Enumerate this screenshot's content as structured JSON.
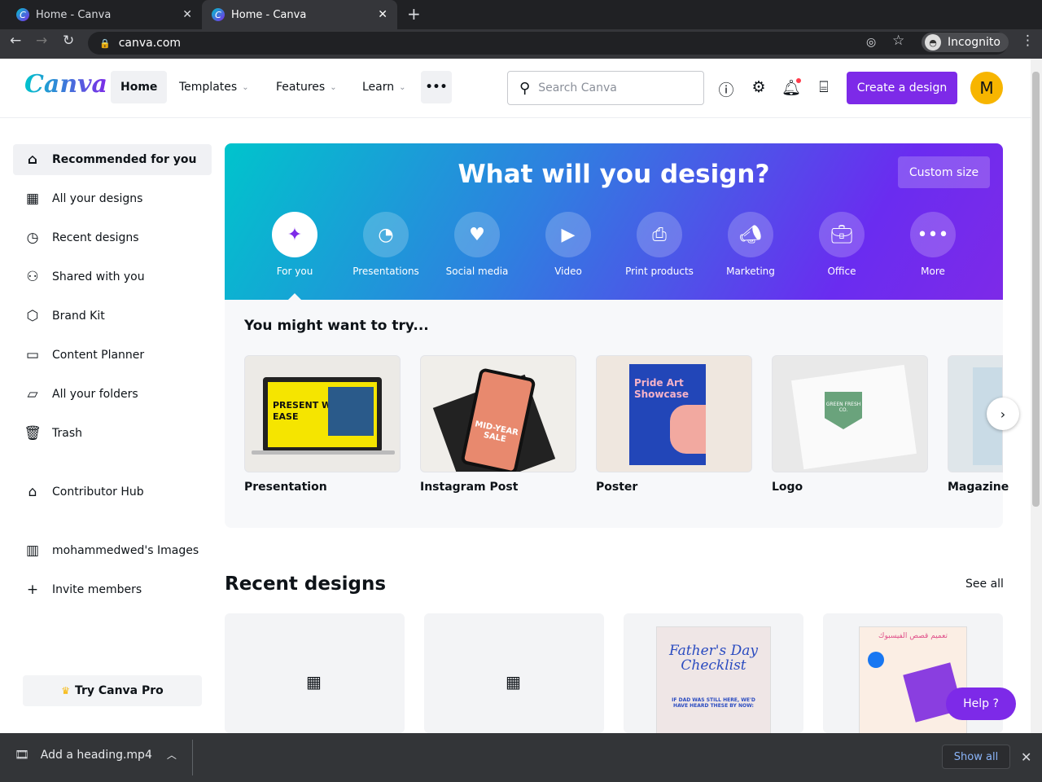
{
  "browser": {
    "tabs": [
      {
        "title": "Home - Canva"
      },
      {
        "title": "Home - Canva"
      }
    ],
    "url": "canva.com",
    "profile": "Incognito"
  },
  "header": {
    "logo": "Canva",
    "nav": [
      {
        "label": "Home"
      },
      {
        "label": "Templates"
      },
      {
        "label": "Features"
      },
      {
        "label": "Learn"
      }
    ],
    "more": "•••",
    "search_placeholder": "Search Canva",
    "create_label": "Create a design",
    "avatar_initial": "M"
  },
  "sidebar": {
    "items": [
      {
        "label": "Recommended for you",
        "icon": "home-icon"
      },
      {
        "label": "All your designs",
        "icon": "grid-icon"
      },
      {
        "label": "Recent designs",
        "icon": "clock-icon"
      },
      {
        "label": "Shared with you",
        "icon": "people-icon"
      },
      {
        "label": "Brand Kit",
        "icon": "brand-icon"
      },
      {
        "label": "Content Planner",
        "icon": "calendar-icon"
      },
      {
        "label": "All your folders",
        "icon": "folder-icon"
      },
      {
        "label": "Trash",
        "icon": "trash-icon"
      },
      {
        "label": "Contributor Hub",
        "icon": "store-icon"
      },
      {
        "label": "mohammedwed's Images",
        "icon": "building-icon"
      },
      {
        "label": "Invite members",
        "icon": "plus-icon"
      }
    ],
    "try_pro": "Try Canva Pro"
  },
  "banner": {
    "title": "What will you design?",
    "custom_size": "Custom size",
    "categories": [
      {
        "label": "For you"
      },
      {
        "label": "Presentations"
      },
      {
        "label": "Social media"
      },
      {
        "label": "Video"
      },
      {
        "label": "Print products"
      },
      {
        "label": "Marketing"
      },
      {
        "label": "Office"
      },
      {
        "label": "More"
      }
    ]
  },
  "suggestions": {
    "title": "You might want to try...",
    "items": [
      {
        "label": "Presentation",
        "thumb_text": "PRESENT WITH EASE"
      },
      {
        "label": "Instagram Post",
        "thumb_text": "MID-YEAR SALE"
      },
      {
        "label": "Poster",
        "thumb_text": "Pride Art Showcase"
      },
      {
        "label": "Logo",
        "thumb_text": "GREEN FRESH CO."
      },
      {
        "label": "Magazine"
      }
    ]
  },
  "recent": {
    "title": "Recent designs",
    "see_all": "See all",
    "designs": [
      {
        "thumb": ""
      },
      {
        "thumb": ""
      },
      {
        "thumb_text": "Father's Day Checklist",
        "sub": "IF DAD WAS STILL HERE, WE'D HAVE HEARD THESE BY NOW:"
      },
      {
        "thumb_text": "تعميم قصص الفيسبوك"
      }
    ]
  },
  "help": "Help ?",
  "download": {
    "file": "Add a heading.mp4",
    "show_all": "Show all"
  }
}
